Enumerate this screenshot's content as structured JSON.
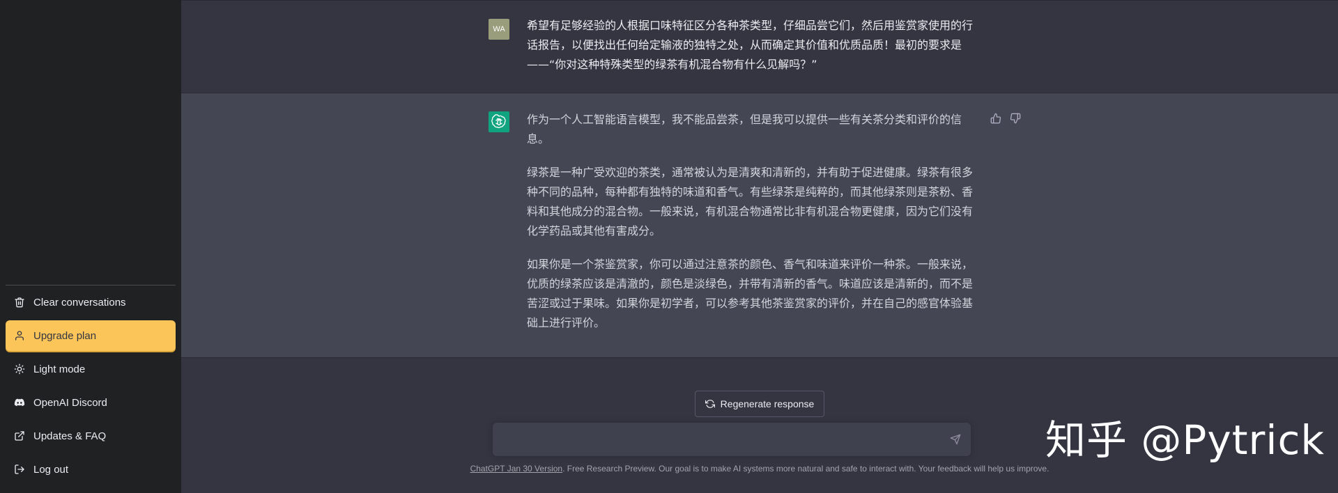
{
  "sidebar": {
    "items": [
      {
        "label": "Clear conversations",
        "icon": "trash-icon"
      },
      {
        "label": "Upgrade plan",
        "icon": "user-icon"
      },
      {
        "label": "Light mode",
        "icon": "sun-icon"
      },
      {
        "label": "OpenAI Discord",
        "icon": "discord-icon"
      },
      {
        "label": "Updates & FAQ",
        "icon": "external-link-icon"
      },
      {
        "label": "Log out",
        "icon": "logout-icon"
      }
    ]
  },
  "conversation": {
    "user": {
      "avatar_initials": "WA",
      "text": "希望有足够经验的人根据口味特征区分各种茶类型，仔细品尝它们，然后用鉴赏家使用的行话报告，以便找出任何给定输液的独特之处，从而确定其价值和优质品质！最初的要求是——“你对这种特殊类型的绿茶有机混合物有什么见解吗？”"
    },
    "assistant": {
      "paragraphs": [
        "作为一个人工智能语言模型，我不能品尝茶，但是我可以提供一些有关茶分类和评价的信息。",
        "绿茶是一种广受欢迎的茶类，通常被认为是清爽和清新的，并有助于促进健康。绿茶有很多种不同的品种，每种都有独特的味道和香气。有些绿茶是纯粹的，而其他绿茶则是茶粉、香料和其他成分的混合物。一般来说，有机混合物通常比非有机混合物更健康，因为它们没有化学药品或其他有害成分。",
        "如果你是一个茶鉴赏家，你可以通过注意茶的颜色、香气和味道来评价一种茶。一般来说，优质的绿茶应该是清澈的，颜色是淡绿色，并带有清新的香气。味道应该是清新的，而不是苦涩或过于果味。如果你是初学者，可以参考其他茶鉴赏家的评价，并在自己的感官体验基础上进行评价。"
      ]
    }
  },
  "composer": {
    "regenerate_label": "Regenerate response",
    "input_value": "",
    "input_placeholder": ""
  },
  "footer": {
    "version_link": "ChatGPT Jan 30 Version",
    "text": ". Free Research Preview. Our goal is to make AI systems more natural and safe to interact with. Your feedback will help us improve."
  },
  "watermark": "知乎 @Pytrick",
  "colors": {
    "sidebar_bg": "#202123",
    "main_bg": "#343541",
    "assistant_bg": "#444654",
    "upgrade_accent": "#fbc55a",
    "gpt_avatar": "#10a37f"
  }
}
